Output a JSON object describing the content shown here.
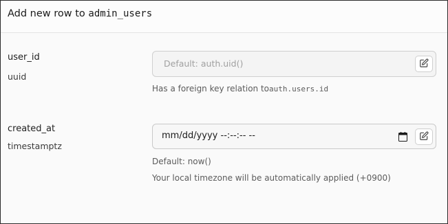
{
  "dialog": {
    "title_prefix": "Add new row to ",
    "table_name": "admin_users"
  },
  "fields": [
    {
      "name": "user_id",
      "type": "uuid",
      "placeholder": "Default: auth.uid()",
      "helper_prefix": "Has a foreign key relation to",
      "helper_ref": "auth.users.id"
    },
    {
      "name": "created_at",
      "type": "timestamptz",
      "value": "mm/dd/yyyy --:--:-- --",
      "helper_default": "Default: now()",
      "helper_timezone": "Your local timezone will be automatically applied (+0900)"
    }
  ],
  "icons": {
    "edit": "edit-icon",
    "calendar": "calendar-icon"
  }
}
